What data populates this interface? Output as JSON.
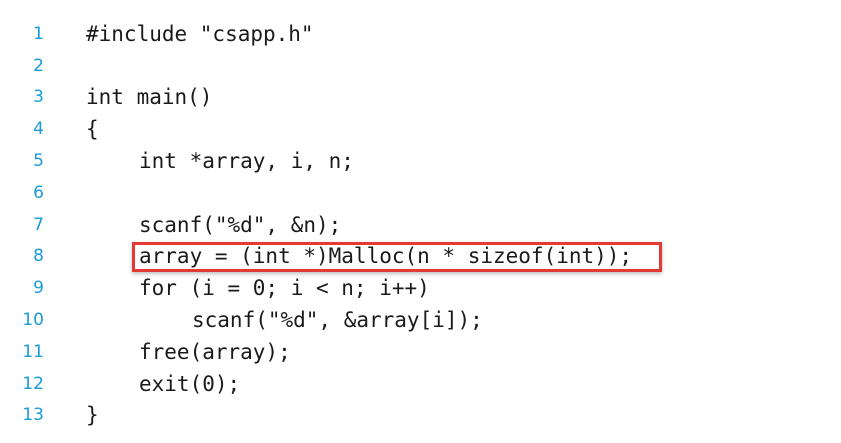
{
  "code": {
    "lines": [
      {
        "number": "1",
        "text": "#include \"csapp.h\""
      },
      {
        "number": "2",
        "text": ""
      },
      {
        "number": "3",
        "text": "int main()"
      },
      {
        "number": "4",
        "text": "{"
      },
      {
        "number": "5",
        "text": "int *array, i, n;"
      },
      {
        "number": "6",
        "text": ""
      },
      {
        "number": "7",
        "text": "scanf(\"%d\", &n);"
      },
      {
        "number": "8",
        "text": "array = (int *)Malloc(n * sizeof(int));"
      },
      {
        "number": "9",
        "text": "for (i = 0; i < n; i++)"
      },
      {
        "number": "10",
        "text": "scanf(\"%d\", &array[i]);"
      },
      {
        "number": "11",
        "text": "free(array);"
      },
      {
        "number": "12",
        "text": "exit(0);"
      },
      {
        "number": "13",
        "text": "}"
      }
    ]
  },
  "colors": {
    "line_number": "#1a9bd7",
    "highlight_border": "#e53935",
    "code_text": "#1a1a1a"
  }
}
